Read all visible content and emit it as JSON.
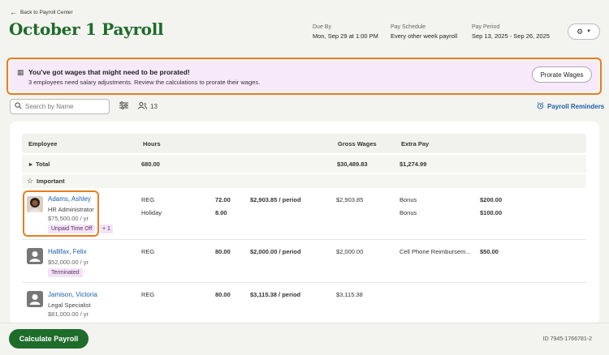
{
  "header": {
    "back_label": "Back to Payroll Center",
    "title": "October 1 Payroll",
    "due_by_label": "Due By",
    "due_by_value": "Mon, Sep 29 at 1:00 PM",
    "schedule_label": "Pay Schedule",
    "schedule_value": "Every other week payroll",
    "period_label": "Pay Period",
    "period_value": "Sep 13, 2025 - Sep 26, 2025"
  },
  "banner": {
    "title": "You've got wages that might need to be prorated!",
    "subtitle": "3 employees need salary adjustments. Review the calculations to prorate their wages.",
    "button_label": "Prorate Wages"
  },
  "toolbar": {
    "search_placeholder": "Search by Name",
    "employee_count": "13",
    "reminders_label": "Payroll Reminders"
  },
  "table": {
    "headers": {
      "employee": "Employee",
      "hours": "Hours",
      "gross": "Gross Wages",
      "extra": "Extra Pay"
    },
    "total": {
      "label": "Total",
      "hours": "680.00",
      "gross": "$30,489.83",
      "extra": "$1,274.99"
    },
    "important_label": "Important",
    "employees": [
      {
        "name": "Adams, Ashley",
        "title": "HR Administrator",
        "rate": "$75,500.00 / yr",
        "tag": "Unpaid Time Off",
        "more": "+ 1",
        "lines": [
          {
            "type": "REG",
            "hours": "72.00",
            "pay": "$2,903.85 / period",
            "gross": "$2,903.85",
            "extra_name": "Bonus",
            "extra_amt": "$200.00"
          },
          {
            "type": "Holiday",
            "hours": "8.00",
            "pay": "",
            "gross": "",
            "extra_name": "Bonus",
            "extra_amt": "$100.00"
          }
        ]
      },
      {
        "name": "Hallifax, Felix",
        "title": "",
        "rate": "$52,000.00 / yr",
        "tag": "Terminated",
        "lines": [
          {
            "type": "REG",
            "hours": "80.00",
            "pay": "$2,000.00 / period",
            "gross": "$2,000.00",
            "extra_name": "Cell Phone Reimbursem...",
            "extra_amt": "$50.00"
          }
        ]
      },
      {
        "name": "Jamison, Victoria",
        "title": "Legal Specialist",
        "rate": "$81,000.00 / yr",
        "lines": [
          {
            "type": "REG",
            "hours": "80.00",
            "pay": "$3,115.38 / period",
            "gross": "$3,115.38"
          }
        ]
      }
    ]
  },
  "footer": {
    "calculate_label": "Calculate Payroll",
    "payroll_id": "ID 7945-1766781-2"
  },
  "colors": {
    "brand_green": "#1e6b2a",
    "highlight_orange": "#e67e22",
    "banner_bg": "#f7e9fa",
    "link_blue": "#1d5fa8"
  }
}
